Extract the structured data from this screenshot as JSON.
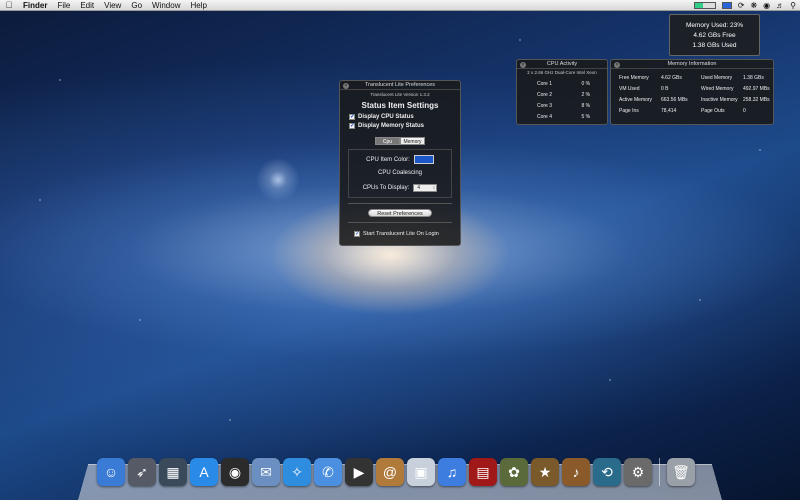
{
  "menubar": {
    "app": "Finder",
    "items": [
      "File",
      "Edit",
      "View",
      "Go",
      "Window",
      "Help"
    ]
  },
  "memory_dropdown": {
    "used": "Memory Used: 23%",
    "free": "4.62 GBs Free",
    "used_amount": "1.38 GBs Used"
  },
  "cpu_activity": {
    "title": "CPU Activity",
    "subtitle": "2 x 2.66 GHz Dual-Core Intel Xeon",
    "cores": [
      {
        "label": "Core 1",
        "value": "0 %"
      },
      {
        "label": "Core 2",
        "value": "2 %"
      },
      {
        "label": "Core 3",
        "value": "8 %"
      },
      {
        "label": "Core 4",
        "value": "5 %"
      }
    ]
  },
  "memory_info": {
    "title": "Memory Information",
    "rows": [
      [
        "Free Memory",
        "4.62 GBs",
        "Used Memory",
        "1.38 GBs"
      ],
      [
        "VM Used",
        "0 B",
        "Wired Memory",
        "492.97 MBs"
      ],
      [
        "Active Memory",
        "663.56 MBs",
        "Inactive Memory",
        "258.32 MBs"
      ],
      [
        "Page Ins",
        "78,414",
        "Page Outs",
        "0"
      ]
    ]
  },
  "prefs": {
    "title": "Translucent Lite Preferences",
    "version": "Translucent Lite Version 1.3.2",
    "heading": "Status Item Settings",
    "display_cpu": "Display CPU Status",
    "display_memory": "Display Memory Status",
    "tab_cpu": "Cpu",
    "tab_memory": "Memory",
    "cpu_item_color_label": "CPU Item Color:",
    "cpu_item_color": "#1c57c7",
    "cpu_coalescing": "CPU Coalescing",
    "cpus_to_display_label": "CPUs To Display:",
    "cpus_to_display_value": "4",
    "reset_button": "Reset Preferences",
    "start_on_login": "Start Translucent Lite On Login"
  },
  "dock": {
    "icons": [
      {
        "name": "finder-icon",
        "color": "#3a7bd5",
        "glyph": "☺"
      },
      {
        "name": "launchpad-icon",
        "color": "#555a66",
        "glyph": "➶"
      },
      {
        "name": "mission-control-icon",
        "color": "#3a4a5a",
        "glyph": "▦"
      },
      {
        "name": "app-store-icon",
        "color": "#2a8ae8",
        "glyph": "A"
      },
      {
        "name": "dashboard-icon",
        "color": "#2b2b2b",
        "glyph": "◉"
      },
      {
        "name": "mail-icon",
        "color": "#6a8fc0",
        "glyph": "✉"
      },
      {
        "name": "safari-icon",
        "color": "#2f8de0",
        "glyph": "✧"
      },
      {
        "name": "ichat-icon",
        "color": "#4a8fe0",
        "glyph": "✆"
      },
      {
        "name": "facetime-icon",
        "color": "#333",
        "glyph": "▶"
      },
      {
        "name": "address-book-icon",
        "color": "#b07a3a",
        "glyph": "@"
      },
      {
        "name": "preview-icon",
        "color": "#c8d0dc",
        "glyph": "▣"
      },
      {
        "name": "itunes-icon",
        "color": "#3d7de0",
        "glyph": "♫"
      },
      {
        "name": "photo-booth-icon",
        "color": "#a01818",
        "glyph": "▤"
      },
      {
        "name": "iphoto-icon",
        "color": "#5a6a3a",
        "glyph": "✿"
      },
      {
        "name": "imovie-icon",
        "color": "#7a5a2a",
        "glyph": "★"
      },
      {
        "name": "garageband-icon",
        "color": "#8a5a2a",
        "glyph": "♪"
      },
      {
        "name": "time-machine-icon",
        "color": "#2a6a8a",
        "glyph": "⟲"
      },
      {
        "name": "system-preferences-icon",
        "color": "#6a6a6a",
        "glyph": "⚙"
      },
      {
        "name": "trash-icon",
        "color": "#9aa0a8",
        "glyph": "🗑"
      }
    ]
  }
}
